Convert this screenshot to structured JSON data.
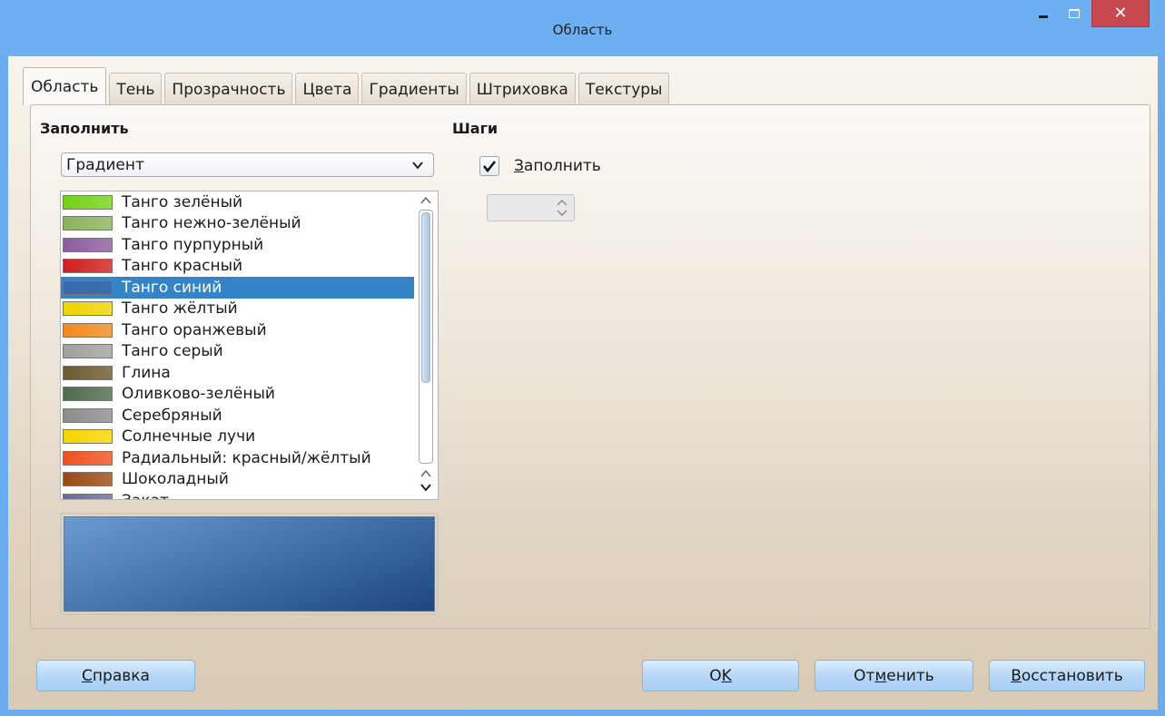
{
  "window": {
    "title": "Область"
  },
  "tabs": [
    {
      "label": "Область",
      "active": true
    },
    {
      "label": "Тень"
    },
    {
      "label": "Прозрачность"
    },
    {
      "label": "Цвета"
    },
    {
      "label": "Градиенты"
    },
    {
      "label": "Штриховка"
    },
    {
      "label": "Текстуры"
    }
  ],
  "fill": {
    "heading": "Заполнить",
    "type_value": "Градиент",
    "gradients": [
      {
        "label": "Танго зелёный",
        "swatch": "#73d216"
      },
      {
        "label": "Танго нежно-зелёный",
        "swatch": "#8ab35a"
      },
      {
        "label": "Танго пурпурный",
        "swatch": "#8e5c9e"
      },
      {
        "label": "Танго красный",
        "swatch": "#d01e1e"
      },
      {
        "label": "Танго синий",
        "swatch": "#3a6aa8",
        "selected": true
      },
      {
        "label": "Танго жёлтый",
        "swatch": "#edd400"
      },
      {
        "label": "Танго оранжевый",
        "swatch": "#f08a1c"
      },
      {
        "label": "Танго серый",
        "swatch": "#9fa19d"
      },
      {
        "label": "Глина",
        "swatch": "#6b5a2e"
      },
      {
        "label": "Оливково-зелёный",
        "swatch": "#4f6a4a"
      },
      {
        "label": "Серебряный",
        "swatch": "#8c8c8c"
      },
      {
        "label": "Солнечные лучи",
        "swatch": "#f6d400"
      },
      {
        "label": "Радиальный: красный/жёлтый",
        "swatch": "#f05020"
      },
      {
        "label": "Шоколадный",
        "swatch": "#9c4a12"
      },
      {
        "label": "Закат",
        "swatch": "#6a6a9a"
      }
    ],
    "preview_colors": [
      "#6a9bd0",
      "#1e4680"
    ]
  },
  "steps": {
    "heading": "Шаги",
    "auto_label_accel": "З",
    "auto_label_rest": "аполнить",
    "auto_checked": true,
    "increment_value": ""
  },
  "buttons": {
    "help_accel": "С",
    "help_rest": "правка",
    "ok_prefix": "O",
    "ok_accel": "K",
    "cancel_prefix": "От",
    "cancel_accel": "м",
    "cancel_rest": "енить",
    "reset_accel": "В",
    "reset_rest": "осстановить"
  }
}
